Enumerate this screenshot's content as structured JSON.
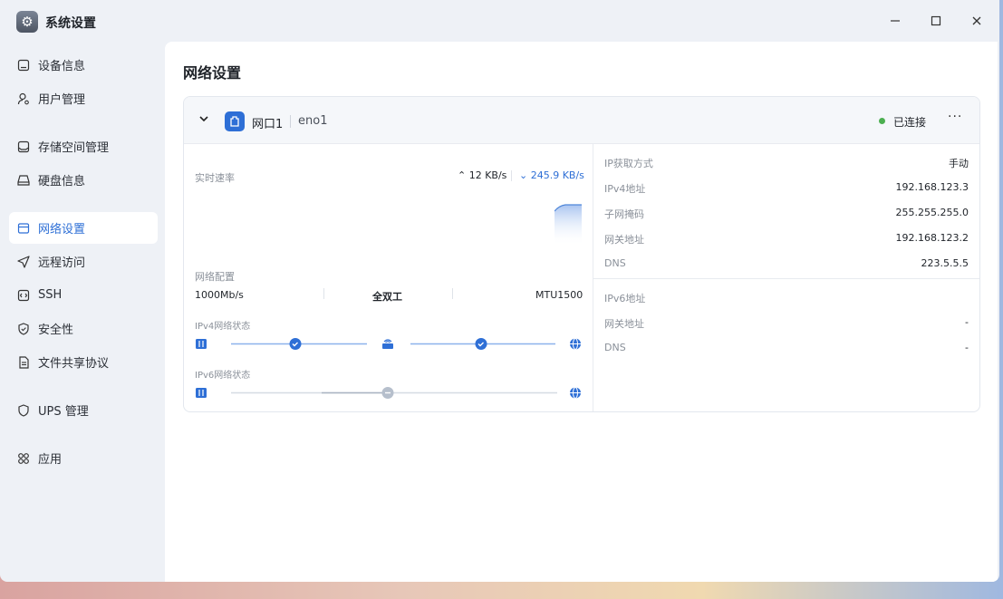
{
  "window": {
    "title": "系统设置"
  },
  "sidebar": {
    "items": [
      {
        "label": "设备信息",
        "icon": "device-info-icon"
      },
      {
        "label": "用户管理",
        "icon": "user-icon"
      },
      {
        "label": "存储空间管理",
        "icon": "storage-icon"
      },
      {
        "label": "硬盘信息",
        "icon": "disk-icon"
      },
      {
        "label": "网络设置",
        "icon": "network-icon",
        "active": true
      },
      {
        "label": "远程访问",
        "icon": "send-icon"
      },
      {
        "label": "SSH",
        "icon": "code-icon"
      },
      {
        "label": "安全性",
        "icon": "shield-icon"
      },
      {
        "label": "文件共享协议",
        "icon": "document-icon"
      },
      {
        "label": "UPS 管理",
        "icon": "ups-shield-icon"
      },
      {
        "label": "应用",
        "icon": "apps-icon"
      }
    ]
  },
  "main": {
    "title": "网络设置",
    "card": {
      "port_name": "网口1",
      "device": "eno1",
      "status": "已连接",
      "status_color": "#4caf50",
      "more": "···",
      "realtime_label": "实时速率",
      "upload": "12 KB/s",
      "download": "245.9 KB/s",
      "config_label": "网络配置",
      "speed": "1000Mb/s",
      "duplex": "全双工",
      "mtu": "MTU1500",
      "ipv4_status_label": "IPv4网络状态",
      "ipv6_status_label": "IPv6网络状态",
      "ipv4_rows": [
        {
          "label": "IP获取方式",
          "value": "手动"
        },
        {
          "label": "IPv4地址",
          "value": "192.168.123.3"
        },
        {
          "label": "子网掩码",
          "value": "255.255.255.0"
        },
        {
          "label": "网关地址",
          "value": "192.168.123.2"
        },
        {
          "label": "DNS",
          "value": "223.5.5.5"
        }
      ],
      "ipv6_rows": [
        {
          "label": "IPv6地址",
          "value": ""
        },
        {
          "label": "网关地址",
          "value": "-"
        },
        {
          "label": "DNS",
          "value": "-"
        }
      ]
    }
  },
  "colors": {
    "accent": "#2e6fd6",
    "active_bg": "#ffffff"
  }
}
